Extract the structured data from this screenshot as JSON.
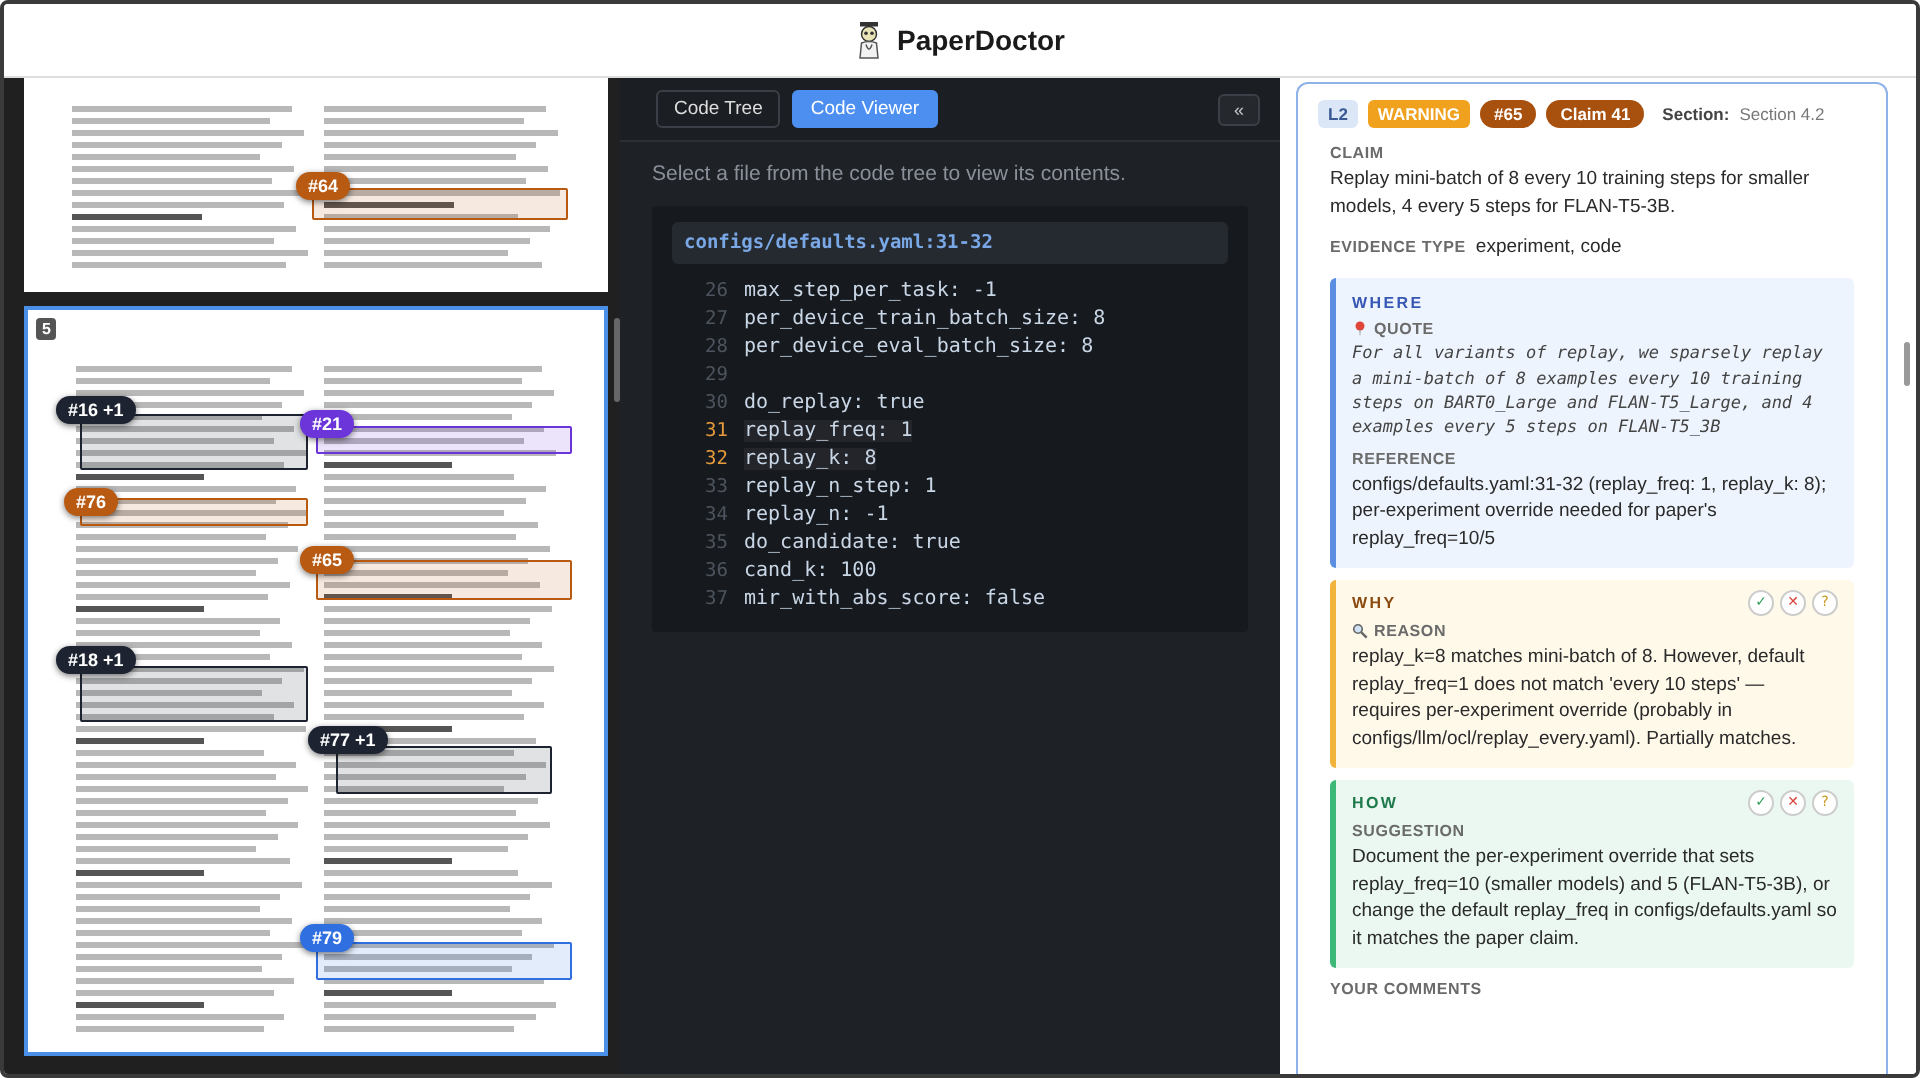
{
  "app": {
    "title": "PaperDoctor"
  },
  "pdf_viewer": {
    "pages": [
      {
        "selected": false,
        "annotations": [
          {
            "label": "#64",
            "color": "#b85a12"
          }
        ]
      },
      {
        "page_label": "5",
        "selected": true,
        "annotations": [
          {
            "label": "#16 +1",
            "color": "#1d2330"
          },
          {
            "label": "#21",
            "color": "#6b35d9"
          },
          {
            "label": "#76",
            "color": "#b85a12"
          },
          {
            "label": "#65",
            "color": "#b85a12"
          },
          {
            "label": "#18 +1",
            "color": "#1d2330"
          },
          {
            "label": "#77 +1",
            "color": "#1d2330"
          },
          {
            "label": "#79",
            "color": "#2f6fe0"
          }
        ]
      }
    ]
  },
  "code_panel": {
    "tabs": [
      {
        "label": "Code Tree",
        "selected": false
      },
      {
        "label": "Code Viewer",
        "selected": true
      }
    ],
    "collapse_button": "«",
    "hint": "Select a file from the code tree to view its contents.",
    "snippet": {
      "file": "configs/defaults.yaml:31-32",
      "lines": [
        {
          "number": "26",
          "text": "max_step_per_task: -1",
          "highlighted": false
        },
        {
          "number": "27",
          "text": "per_device_train_batch_size: 8",
          "highlighted": false
        },
        {
          "number": "28",
          "text": "per_device_eval_batch_size: 8",
          "highlighted": false
        },
        {
          "number": "29",
          "highlighted": false
        },
        {
          "number": "30",
          "text": "do_replay: true",
          "highlighted": false
        },
        {
          "number": "31",
          "text": "replay_freq: 1",
          "highlighted": true
        },
        {
          "number": "32",
          "text": "replay_k: 8",
          "highlighted": true
        },
        {
          "number": "33",
          "text": "replay_n_step: 1",
          "highlighted": false
        },
        {
          "number": "34",
          "text": "replay_n: -1",
          "highlighted": false
        },
        {
          "number": "35",
          "text": "do_candidate: true",
          "highlighted": false
        },
        {
          "number": "36",
          "text": "cand_k: 100",
          "highlighted": false
        },
        {
          "number": "37",
          "text": "mir_with_abs_score: false",
          "highlighted": false
        }
      ]
    }
  },
  "review": {
    "level": "L2",
    "severity": "WARNING",
    "annotation": "#65",
    "claim_id": "Claim 41",
    "section_label": "Section:",
    "section": "Section 4.2",
    "claim_label": "CLAIM",
    "claim": "Replay mini-batch of 8 every 10 training steps for smaller models, 4 every 5 steps for FLAN-T5-3B.",
    "evidence_label": "EVIDENCE TYPE",
    "evidence": "experiment, code",
    "blocks": [
      {
        "kind": "where",
        "title": "WHERE",
        "items": [
          {
            "kind": "quote",
            "label": "QUOTE",
            "text": "For all variants of replay, we sparsely replay a mini-batch of 8 examples every 10 training steps on BART0_Large and FLAN-T5_Large, and 4 examples every 5 steps on FLAN-T5_3B"
          },
          {
            "kind": "plain",
            "label": "REFERENCE",
            "text": "configs/defaults.yaml:31-32 (replay_freq: 1, replay_k: 8); per-experiment override needed for paper's replay_freq=10/5"
          }
        ]
      },
      {
        "kind": "why",
        "title": "WHY",
        "actions": [
          "✓",
          "✕",
          "?"
        ],
        "items": [
          {
            "kind": "reason",
            "label": "REASON",
            "text": "replay_k=8 matches mini-batch of 8. However, default replay_freq=1 does not match 'every 10 steps' — requires per-experiment override (probably in configs/llm/ocl/replay_every.yaml). Partially matches."
          }
        ]
      },
      {
        "kind": "how",
        "title": "HOW",
        "actions": [
          "✓",
          "✕",
          "?"
        ],
        "items": [
          {
            "kind": "plain",
            "label": "SUGGESTION",
            "text": "Document the per-experiment override that sets replay_freq=10 (smaller models) and 5 (FLAN-T5-3B), or change the default replay_freq in configs/defaults.yaml so it matches the paper claim."
          }
        ]
      }
    ],
    "comments_label": "YOUR COMMENTS"
  }
}
